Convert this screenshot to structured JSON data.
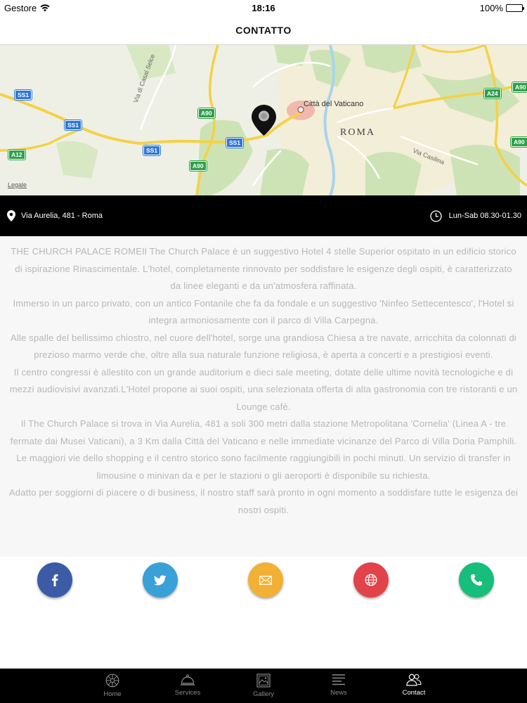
{
  "status_bar": {
    "carrier": "Gestore",
    "time": "18:16",
    "battery": "100%"
  },
  "nav": {
    "title": "CONTATTO"
  },
  "map": {
    "legal": "Legale",
    "labels": {
      "vatican": "Città del Vaticano",
      "roma": "ROMA",
      "via_casal_selce": "Via di Casal Selce",
      "via_casilina": "Via Casilina"
    },
    "road_shields": {
      "ss1": "SS1",
      "a90": "A90",
      "a12": "A12",
      "a24": "A24"
    }
  },
  "info_bar": {
    "address": "Via Aurelia, 481 - Roma",
    "hours": "Lun-Sab 08.30-01.30"
  },
  "description": {
    "paragraphs": [
      "THE CHURCH PALACE ROMEIl The Church Palace è un suggestivo Hotel 4 stelle Superior ospitato in un edificio storico di ispirazione Rinascimentale. L'hotel, completamente rinnovato per soddisfare le esigenze degli ospiti, è caratterizzato da linee eleganti e da un'atmosfera raffinata.",
      "Immerso in un parco privato, con un antico Fontanile che fa da fondale e un suggestivo 'Ninfeo Settecentesco', l'Hotel si integra armoniosamente con il parco di Villa Carpegna.",
      "Alle spalle del bellissimo chiostro, nel cuore dell'hotel, sorge una grandiosa Chiesa a tre navate, arricchita da colonnati di prezioso marmo verde che, oltre alla sua naturale funzione religiosa, è aperta a concerti e a prestigiosi eventi.",
      "Il centro congressi è allestito con un grande auditorium e dieci sale meeting, dotate delle ultime novità tecnologiche e di mezzi audiovisivi avanzati.L'Hotel propone ai suoi ospiti, una selezionata offerta di alta gastronomia con tre ristoranti e un Lounge cafè.",
      "Il The Church Palace si trova in Via Aurelia, 481 a soli 300 metri dalla stazione Metropolitana 'Cornelia' (Linea A - tre fermate dai Musei Vaticani), a 3 Km dalla Città del Vaticano e nelle immediate vicinanze del Parco di Villa Doria Pamphili. Le maggiori vie dello shopping e il centro storico sono facilmente raggiungibili in pochi minuti. Un servizio di transfer in limousine o minivan da e per le stazioni o gli aeroporti è disponibile su richiesta.",
      "Adatto per soggiorni di piacere o di business, il nostro staff sarà pronto in ogni momento a soddisfare tutte le esigenza dei nostri ospiti."
    ]
  },
  "social": {
    "facebook_icon": "facebook-icon",
    "twitter_icon": "twitter-icon",
    "email_icon": "envelope-icon",
    "web_icon": "globe-icon",
    "phone_icon": "phone-icon",
    "colors": {
      "facebook": "#3b5ba6",
      "twitter": "#3aa0d8",
      "email": "#f2b134",
      "web": "#e2434b",
      "phone": "#17bd7a"
    }
  },
  "tabs": [
    {
      "label": "Home",
      "icon": "wheel-icon",
      "active": false
    },
    {
      "label": "Services",
      "icon": "service-bell-icon",
      "active": false
    },
    {
      "label": "Gallery",
      "icon": "picture-icon",
      "active": false
    },
    {
      "label": "News",
      "icon": "news-lines-icon",
      "active": false
    },
    {
      "label": "Contact",
      "icon": "people-icon",
      "active": true
    }
  ]
}
